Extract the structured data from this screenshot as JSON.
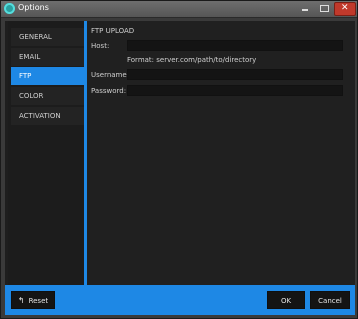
{
  "window": {
    "title": "Options"
  },
  "sidebar": {
    "items": [
      {
        "label": "GENERAL"
      },
      {
        "label": "EMAIL"
      },
      {
        "label": "FTP"
      },
      {
        "label": "COLOR"
      },
      {
        "label": "ACTIVATION"
      }
    ],
    "selected": "FTP"
  },
  "content": {
    "section_title": "FTP UPLOAD",
    "host_label": "Host:",
    "host_value": "",
    "format_hint": "Format: server.com/path/to/directory",
    "username_label": "Username:",
    "username_value": "",
    "password_label": "Password:",
    "password_value": ""
  },
  "footer": {
    "reset_label": "Reset",
    "ok_label": "OK",
    "cancel_label": "Cancel"
  },
  "colors": {
    "accent": "#1e88e5"
  },
  "icons": {
    "reset": "undo-arrow-icon"
  }
}
